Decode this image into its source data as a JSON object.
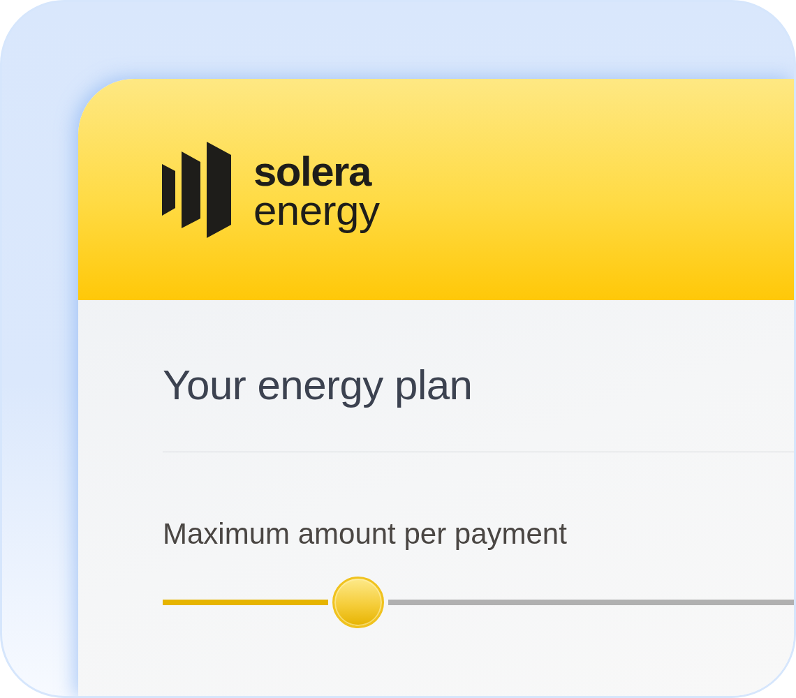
{
  "logo": {
    "wordmark_line_1": "solera",
    "wordmark_line_2": "energy"
  },
  "plan": {
    "title": "Your energy plan",
    "slider": {
      "label": "Maximum amount per payment",
      "level": 0.31
    }
  }
}
